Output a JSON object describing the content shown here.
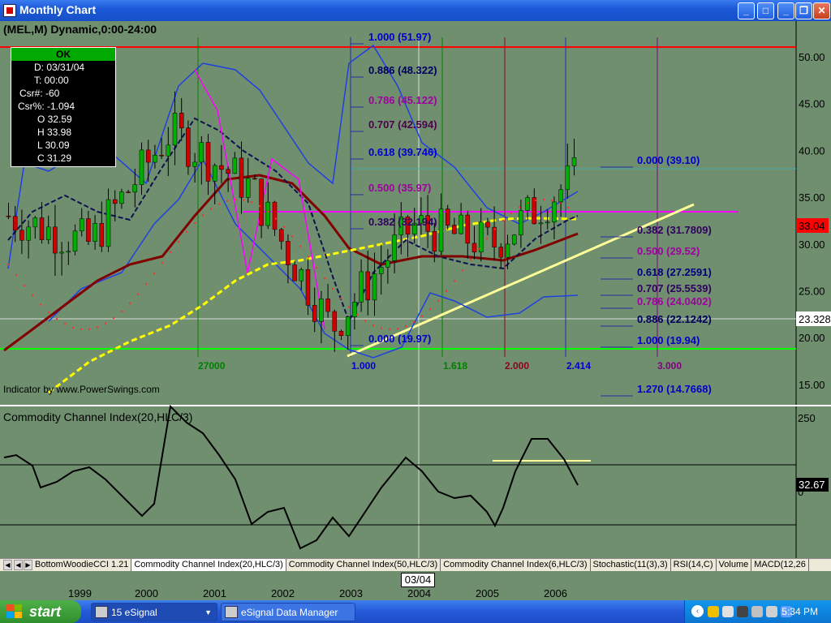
{
  "window": {
    "title": "Monthly Chart"
  },
  "chart": {
    "symbol_line": "(MEL,M) Dynamic,0:00-24:00",
    "indicator_credit": "Indicator by www.PowerSwings.com",
    "last_price": "33.04",
    "crosshair_price": "23.328",
    "price_axis": [
      "50.00",
      "45.00",
      "40.00",
      "35.00",
      "30.00",
      "25.00",
      "20.00",
      "15.00"
    ],
    "fib_retracement_top": [
      "1.000 (51.97)",
      "0.886 (48.322)",
      "0.786 (45.122)",
      "0.707 (42.594)",
      "0.618 (39.746)",
      "0.500 (35.97)",
      "0.382 (32.194)",
      "0.000 (19.97)"
    ],
    "fib_retracement_right": [
      "0.000 (39.10)",
      "0.382 (31.7809)",
      "0.500 (29.52)",
      "0.618 (27.2591)",
      "0.707 (25.5539)",
      "0.786 (24.0402)",
      "0.886 (22.1242)",
      "1.000 (19.94)",
      "1.270 (14.7668)"
    ],
    "fib_time": [
      "1.000",
      "1.618",
      "2.000",
      "2.414",
      "3.000"
    ],
    "time_origin_label": "27000",
    "colors": {
      "background": "#6f8f6f",
      "up": "#00b000",
      "down": "#d00000",
      "resistance": "#ff0000",
      "support": "#00ff00",
      "trendline": "#ffff99",
      "magenta": "#ff00ff"
    }
  },
  "data_box": {
    "header": "OK",
    "rows": [
      "D: 03/31/04",
      "T: 00:00",
      "Csr#: -60",
      "Csr%: -1.094",
      "O 32.59",
      "H 33.98",
      "L 30.09",
      "C 31.29"
    ]
  },
  "cci": {
    "title": "Commodity Channel Index(20,HLC/3)",
    "axis": [
      "250",
      "0"
    ],
    "current": "32.67"
  },
  "chart_data": {
    "type": "line",
    "title": "(MEL,M) Dynamic,0:00-24:00",
    "xlabel": "",
    "ylabel": "",
    "x": [
      "1999",
      "2000",
      "2001",
      "2002",
      "2003",
      "2004",
      "2005",
      "2006"
    ],
    "series": [
      {
        "name": "",
        "values": [
          33,
          30,
          42,
          36,
          21,
          32,
          30,
          37
        ]
      }
    ],
    "ylim": [
      13,
      54
    ],
    "grid": false
  },
  "tabs": [
    "BottomWoodieCCI 1.21",
    "Commodity Channel Index(20,HLC/3)",
    "Commodity Channel Index(50,HLC/3)",
    "Commodity Channel Index(6,HLC/3)",
    "Stochastic(11(3),3)",
    "RSI(14,C)",
    "Volume",
    "MACD(12,26"
  ],
  "time_axis": {
    "years": [
      "1999",
      "2000",
      "2001",
      "2002",
      "2003",
      "2004",
      "2005",
      "2006"
    ],
    "cursor_date": "03/04"
  },
  "taskbar": {
    "start_label": "start",
    "buttons": [
      {
        "label": "15 eSignal"
      },
      {
        "label": "eSignal Data Manager"
      }
    ],
    "clock": "5:34 PM"
  }
}
